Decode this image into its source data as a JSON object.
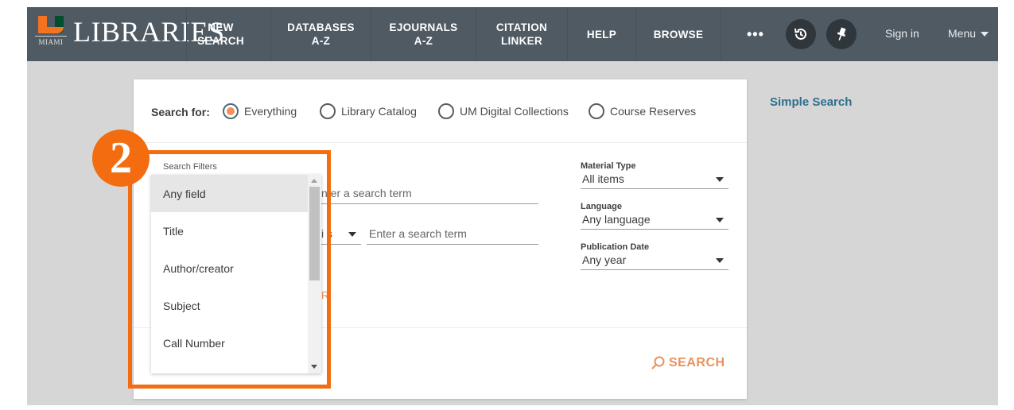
{
  "header": {
    "logo_text": "MIAMI",
    "brand": "LIBRARIES",
    "nav": [
      {
        "line1": "NEW",
        "line2": "SEARCH"
      },
      {
        "line1": "DATABASES",
        "line2": "A-Z"
      },
      {
        "line1": "EJOURNALS",
        "line2": "A-Z"
      },
      {
        "line1": "CITATION",
        "line2": "LINKER"
      },
      {
        "line1": "HELP",
        "line2": ""
      },
      {
        "line1": "BROWSE",
        "line2": ""
      }
    ],
    "more": "•••",
    "icons": [
      "history-icon",
      "pin-icon"
    ],
    "sign_in": "Sign in",
    "menu": "Menu"
  },
  "search": {
    "search_for_label": "Search for:",
    "scopes": [
      {
        "label": "Everything",
        "selected": true
      },
      {
        "label": "Library Catalog",
        "selected": false
      },
      {
        "label": "UM Digital Collections",
        "selected": false
      },
      {
        "label": "Course Reserves",
        "selected": false
      }
    ],
    "row1_placeholder_visible": "n er a search term",
    "row2_operator_visible": "i s",
    "row2_placeholder": "Enter a search term",
    "add_row_visible": "R",
    "filters": [
      {
        "label": "Material Type",
        "value": "All items"
      },
      {
        "label": "Language",
        "value": "Any language"
      },
      {
        "label": "Publication Date",
        "value": "Any year"
      }
    ],
    "search_button": "SEARCH",
    "simple_search_link": "Simple Search"
  },
  "dropdown": {
    "label": "Search Filters",
    "items": [
      {
        "label": "Any field",
        "selected": true
      },
      {
        "label": "Title",
        "selected": false
      },
      {
        "label": "Author/creator",
        "selected": false
      },
      {
        "label": "Subject",
        "selected": false
      },
      {
        "label": "Call Number",
        "selected": false
      }
    ]
  },
  "annotation": {
    "number": "2",
    "color": "#f36c0f"
  },
  "colors": {
    "nav_bg": "#4f5a62",
    "accent_orange": "#e8925d",
    "link_blue": "#2e6f8e"
  }
}
